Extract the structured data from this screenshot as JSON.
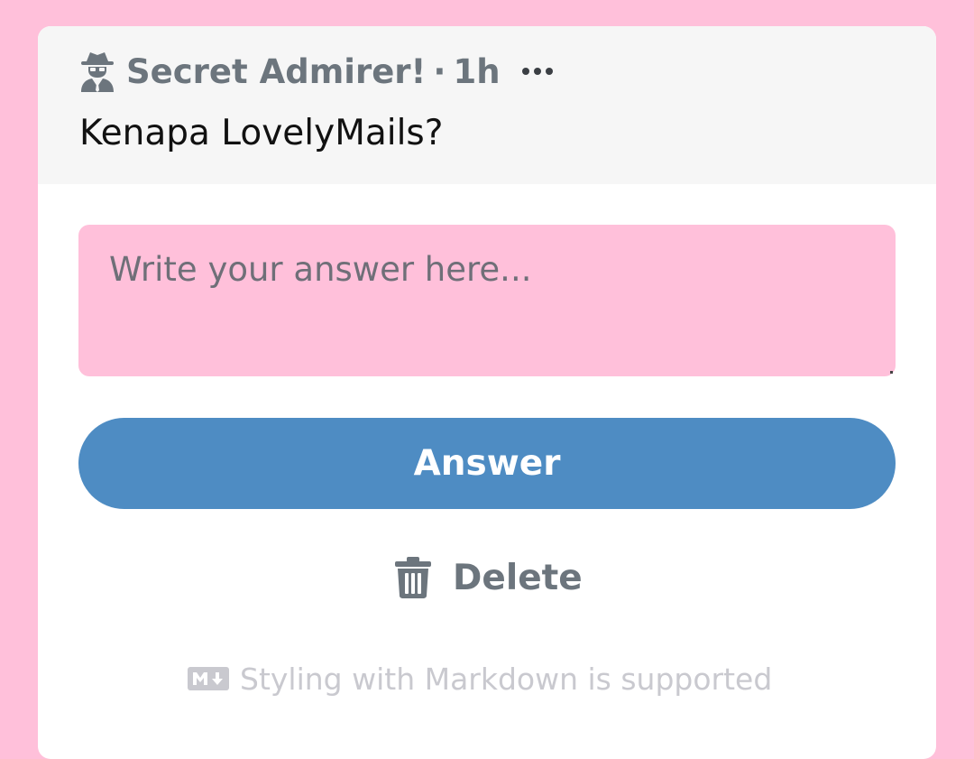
{
  "post": {
    "author": "Secret Admirer!",
    "separator": "·",
    "time": "1h",
    "question": "Kenapa LovelyMails?"
  },
  "answer": {
    "placeholder": "Write your answer here...",
    "value": "",
    "button_label": "Answer"
  },
  "actions": {
    "delete_label": "Delete"
  },
  "footer": {
    "markdown_note": "Styling with Markdown is supported"
  },
  "icons": {
    "author_icon": "user-secret-icon",
    "more_icon": "ellipsis-icon",
    "delete_icon": "trash-icon",
    "markdown_icon": "markdown-icon"
  },
  "colors": {
    "page_background": "#ffc0da",
    "card_background": "#ffffff",
    "header_background": "#f6f6f6",
    "input_background": "#ffc0da",
    "primary_button": "#4e8cc3",
    "muted_text": "#6c757d",
    "hint_text": "#c9c9cf"
  }
}
